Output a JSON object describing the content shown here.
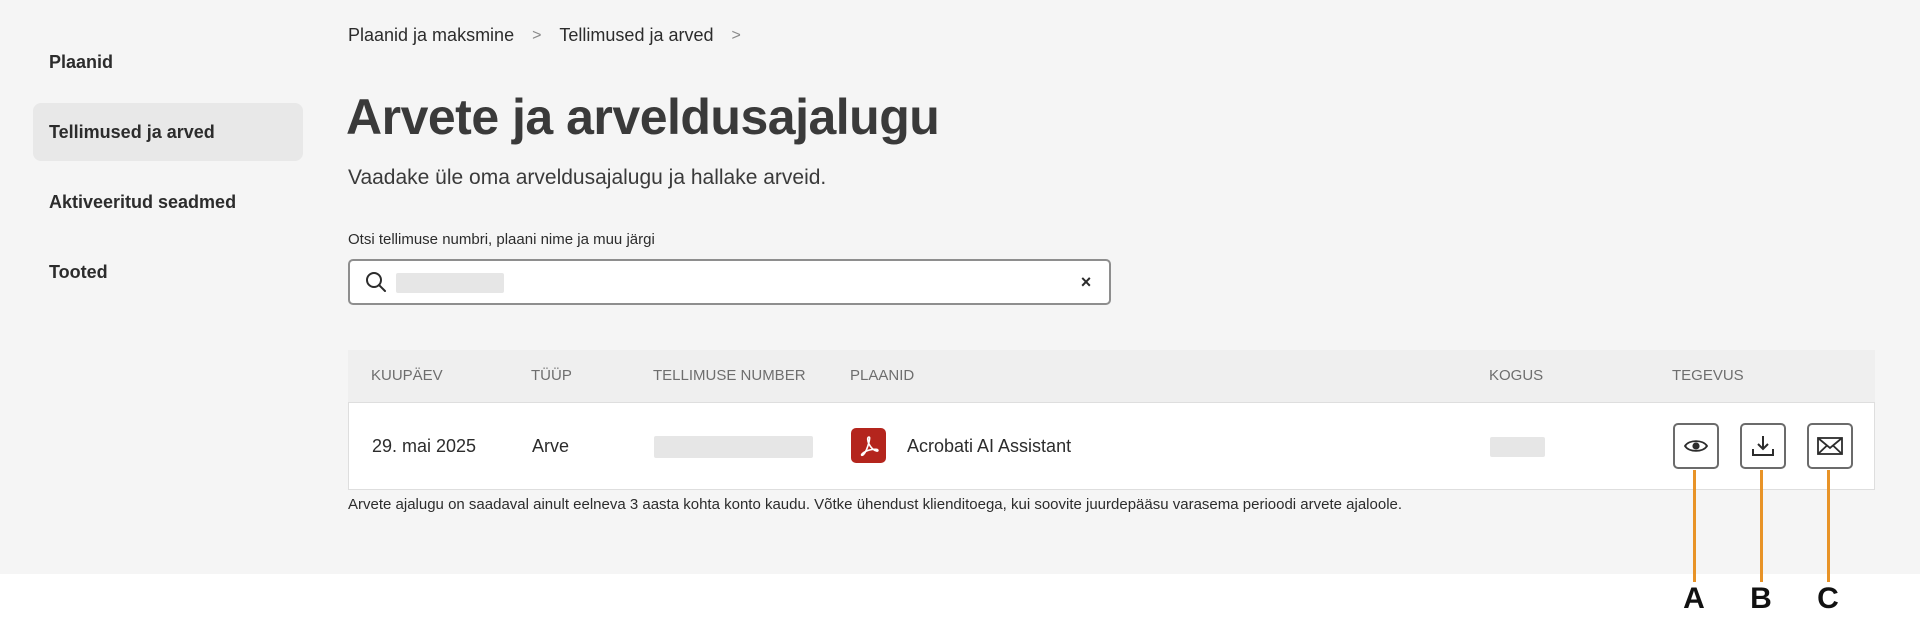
{
  "sidebar": {
    "items": [
      {
        "label": "Plaanid",
        "active": false
      },
      {
        "label": "Tellimused ja arved",
        "active": true
      },
      {
        "label": "Aktiveeritud seadmed",
        "active": false
      },
      {
        "label": "Tooted",
        "active": false
      }
    ]
  },
  "breadcrumb": {
    "items": [
      "Plaanid ja maksmine",
      "Tellimused ja arved"
    ],
    "separator": ">"
  },
  "page": {
    "title": "Arvete ja arveldusajalugu",
    "subtitle": "Vaadake üle oma arveldusajalugu ja hallake arveid."
  },
  "search": {
    "label": "Otsi tellimuse numbri, plaani nime ja muu järgi",
    "value": "",
    "clear_glyph": "×"
  },
  "table": {
    "columns": [
      "KUUPÄEV",
      "TÜÜP",
      "TELLIMUSE NUMBER",
      "PLAANID",
      "KOGUS",
      "TEGEVUS"
    ],
    "rows": [
      {
        "date": "29. mai 2025",
        "type": "Arve",
        "order_number": "",
        "plan": "Acrobati AI Assistant",
        "plan_icon": "acrobat-pdf-icon",
        "quantity": "",
        "actions": [
          "view-icon",
          "download-icon",
          "email-icon"
        ]
      }
    ]
  },
  "footnote": "Arvete ajalugu on saadaval ainult eelneva 3 aasta kohta konto kaudu. Võtke ühendust klienditoega, kui soovite juurdepääsu varasema perioodi arvete ajaloole.",
  "callouts": {
    "labels": [
      "A",
      "B",
      "C"
    ],
    "color": "#e89327"
  },
  "colors": {
    "background": "#f5f5f5",
    "acrobat_red": "#b4251d",
    "active_nav": "#e8e8e8"
  }
}
